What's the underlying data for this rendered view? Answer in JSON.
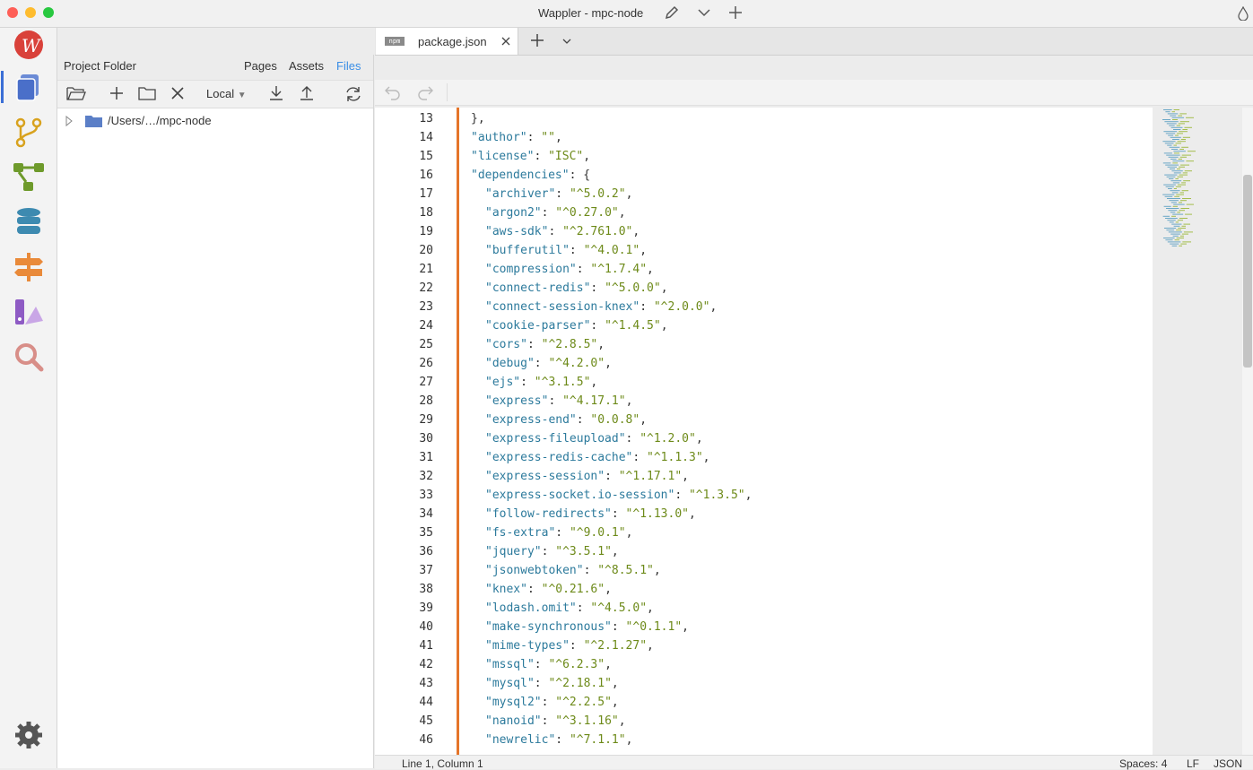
{
  "window": {
    "title": "Wappler - mpc-node"
  },
  "sidebar": {
    "items": [
      "logo-icon",
      "pages-icon",
      "git-icon",
      "workflow-icon",
      "database-icon",
      "routing-icon",
      "design-icon",
      "search-icon",
      "settings-icon"
    ]
  },
  "panel": {
    "title": "Project Folder",
    "tabs": [
      "Pages",
      "Assets",
      "Files"
    ],
    "active_tab": "Files",
    "location": "Local",
    "tree": [
      {
        "label": "/Users/…/mpc-node"
      }
    ]
  },
  "editor": {
    "tab_label": "package.json",
    "tab_badge": "npm",
    "lines": [
      {
        "n": "13",
        "indent": 0,
        "pre": "},",
        "key": "",
        "val": "",
        "post": ""
      },
      {
        "n": "14",
        "indent": 0,
        "pre": "",
        "key": "\"author\"",
        "val": "\"\"",
        "post": ","
      },
      {
        "n": "15",
        "indent": 0,
        "pre": "",
        "key": "\"license\"",
        "val": "\"ISC\"",
        "post": ","
      },
      {
        "n": "16",
        "indent": 0,
        "pre": "",
        "key": "\"dependencies\"",
        "val": "",
        "post": ": {"
      },
      {
        "n": "17",
        "indent": 1,
        "pre": "",
        "key": "\"archiver\"",
        "val": "\"^5.0.2\"",
        "post": ","
      },
      {
        "n": "18",
        "indent": 1,
        "pre": "",
        "key": "\"argon2\"",
        "val": "\"^0.27.0\"",
        "post": ","
      },
      {
        "n": "19",
        "indent": 1,
        "pre": "",
        "key": "\"aws-sdk\"",
        "val": "\"^2.761.0\"",
        "post": ","
      },
      {
        "n": "20",
        "indent": 1,
        "pre": "",
        "key": "\"bufferutil\"",
        "val": "\"^4.0.1\"",
        "post": ","
      },
      {
        "n": "21",
        "indent": 1,
        "pre": "",
        "key": "\"compression\"",
        "val": "\"^1.7.4\"",
        "post": ","
      },
      {
        "n": "22",
        "indent": 1,
        "pre": "",
        "key": "\"connect-redis\"",
        "val": "\"^5.0.0\"",
        "post": ","
      },
      {
        "n": "23",
        "indent": 1,
        "pre": "",
        "key": "\"connect-session-knex\"",
        "val": "\"^2.0.0\"",
        "post": ","
      },
      {
        "n": "24",
        "indent": 1,
        "pre": "",
        "key": "\"cookie-parser\"",
        "val": "\"^1.4.5\"",
        "post": ","
      },
      {
        "n": "25",
        "indent": 1,
        "pre": "",
        "key": "\"cors\"",
        "val": "\"^2.8.5\"",
        "post": ","
      },
      {
        "n": "26",
        "indent": 1,
        "pre": "",
        "key": "\"debug\"",
        "val": "\"^4.2.0\"",
        "post": ","
      },
      {
        "n": "27",
        "indent": 1,
        "pre": "",
        "key": "\"ejs\"",
        "val": "\"^3.1.5\"",
        "post": ","
      },
      {
        "n": "28",
        "indent": 1,
        "pre": "",
        "key": "\"express\"",
        "val": "\"^4.17.1\"",
        "post": ","
      },
      {
        "n": "29",
        "indent": 1,
        "pre": "",
        "key": "\"express-end\"",
        "val": "\"0.0.8\"",
        "post": ","
      },
      {
        "n": "30",
        "indent": 1,
        "pre": "",
        "key": "\"express-fileupload\"",
        "val": "\"^1.2.0\"",
        "post": ","
      },
      {
        "n": "31",
        "indent": 1,
        "pre": "",
        "key": "\"express-redis-cache\"",
        "val": "\"^1.1.3\"",
        "post": ","
      },
      {
        "n": "32",
        "indent": 1,
        "pre": "",
        "key": "\"express-session\"",
        "val": "\"^1.17.1\"",
        "post": ","
      },
      {
        "n": "33",
        "indent": 1,
        "pre": "",
        "key": "\"express-socket.io-session\"",
        "val": "\"^1.3.5\"",
        "post": ","
      },
      {
        "n": "34",
        "indent": 1,
        "pre": "",
        "key": "\"follow-redirects\"",
        "val": "\"^1.13.0\"",
        "post": ","
      },
      {
        "n": "35",
        "indent": 1,
        "pre": "",
        "key": "\"fs-extra\"",
        "val": "\"^9.0.1\"",
        "post": ","
      },
      {
        "n": "36",
        "indent": 1,
        "pre": "",
        "key": "\"jquery\"",
        "val": "\"^3.5.1\"",
        "post": ","
      },
      {
        "n": "37",
        "indent": 1,
        "pre": "",
        "key": "\"jsonwebtoken\"",
        "val": "\"^8.5.1\"",
        "post": ","
      },
      {
        "n": "38",
        "indent": 1,
        "pre": "",
        "key": "\"knex\"",
        "val": "\"^0.21.6\"",
        "post": ","
      },
      {
        "n": "39",
        "indent": 1,
        "pre": "",
        "key": "\"lodash.omit\"",
        "val": "\"^4.5.0\"",
        "post": ","
      },
      {
        "n": "40",
        "indent": 1,
        "pre": "",
        "key": "\"make-synchronous\"",
        "val": "\"^0.1.1\"",
        "post": ","
      },
      {
        "n": "41",
        "indent": 1,
        "pre": "",
        "key": "\"mime-types\"",
        "val": "\"^2.1.27\"",
        "post": ","
      },
      {
        "n": "42",
        "indent": 1,
        "pre": "",
        "key": "\"mssql\"",
        "val": "\"^6.2.3\"",
        "post": ","
      },
      {
        "n": "43",
        "indent": 1,
        "pre": "",
        "key": "\"mysql\"",
        "val": "\"^2.18.1\"",
        "post": ","
      },
      {
        "n": "44",
        "indent": 1,
        "pre": "",
        "key": "\"mysql2\"",
        "val": "\"^2.2.5\"",
        "post": ","
      },
      {
        "n": "45",
        "indent": 1,
        "pre": "",
        "key": "\"nanoid\"",
        "val": "\"^3.1.16\"",
        "post": ","
      },
      {
        "n": "46",
        "indent": 1,
        "pre": "",
        "key": "\"newrelic\"",
        "val": "\"^7.1.1\"",
        "post": ","
      }
    ]
  },
  "status": {
    "position": "Line 1, Column 1",
    "spaces": "Spaces: 4",
    "eol": "LF",
    "language": "JSON"
  },
  "colors": {
    "accent": "#3a8ee6",
    "gutter_marker": "#e5752a",
    "json_key": "#2c7a9c",
    "json_value": "#6d8a19"
  }
}
